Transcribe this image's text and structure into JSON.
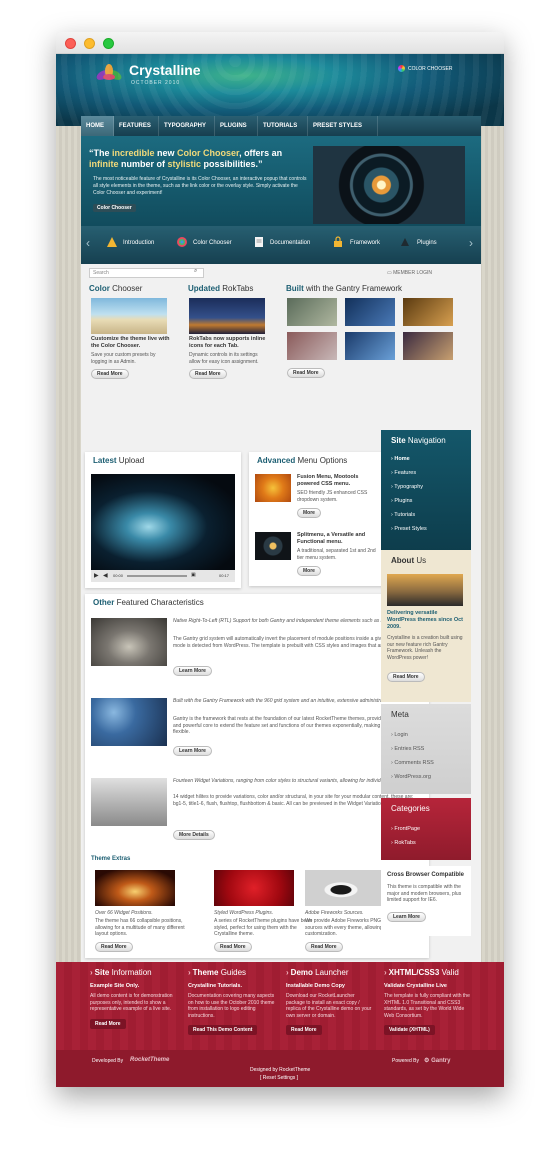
{
  "site": {
    "title": "Crystalline",
    "subtitle": "OCTOBER 2010",
    "color_chooser": "COLOR CHOOSER"
  },
  "nav": [
    "HOME",
    "FEATURES",
    "TYPOGRAPHY",
    "PLUGINS",
    "TUTORIALS",
    "PRESET STYLES"
  ],
  "showcase": {
    "quote_open": "“",
    "quote_1": "The ",
    "quote_hl1": "incredible",
    "quote_2": " new ",
    "quote_hl2": "Color Chooser",
    "quote_3": ", offers an ",
    "quote_hl3": "infinite",
    "quote_4": " number of ",
    "quote_hl4": "stylistic",
    "quote_5": " possibilities.",
    "quote_close": "”",
    "body": "The most noticeable feature of Crystalline is its Color Chooser, an interactive popup that controls all style elements in the theme, such as the link color or the overlay style. Simply activate the Color Chooser and experiment!",
    "button": "Color Chooser",
    "tabs": [
      "Introduction",
      "Color Chooser",
      "Documentation",
      "Framework",
      "Plugins"
    ]
  },
  "toolbar": {
    "search_placeholder": "Search",
    "member_login": "MEMBER LOGIN"
  },
  "features": [
    {
      "title_b": "Color",
      "title_r": " Chooser",
      "bold": "Customize the theme live with the Color Chooser.",
      "text": "Save your custom presets by logging in as Admin.",
      "btn": "Read More"
    },
    {
      "title_b": "Updated",
      "title_r": " RokTabs",
      "bold": "RokTabs now supports inline icons for each Tab.",
      "text": "Dynamic controls in its settings allow for easy icon assignment.",
      "btn": "Read More"
    },
    {
      "title_b": "Built",
      "title_r": " with the Gantry Framework",
      "btn": "Read More"
    }
  ],
  "latest_upload": {
    "title_b": "Latest",
    "title_r": " Upload",
    "time": "00:00",
    "duration": "00:17"
  },
  "advanced_menu": {
    "title_b": "Advanced",
    "title_r": " Menu Options",
    "items": [
      {
        "bold": "Fusion Menu, Mootools powered CSS menu.",
        "text": "SEO friendly JS enhanced CSS dropdown system.",
        "btn": "More"
      },
      {
        "bold": "Splitmenu, a Versatile and Functional menu.",
        "text": "A traditional, separated 1st and 2nd tier menu system.",
        "btn": "More"
      }
    ]
  },
  "other_features": {
    "title_b": "Other",
    "title_r": " Featured Characteristics",
    "items": [
      {
        "italic": "Native Right-To-Left (RTL) Support for both Gantry and independent theme elements such as module styling.",
        "text": "The Gantry grid system will automatically invert the placement of module positions inside a given row when RTL mode is detected from WordPress. The template is prebuilt with CSS styles and images that are peculiar to RTL.",
        "btn": "Learn More"
      },
      {
        "italic": "Built with the Gantry Framework with the 960 grid system and an intuitive, extensive administrative interface.",
        "text": "Gantry is the framework that rests at the foundation of our latest RocketTheme themes, providing an extensive and powerful core to extend the feature set and functions of our themes exponentially, making them even more flexible.",
        "btn": "Learn More"
      },
      {
        "italic": "Fourteen Widget Variations, ranging from color styles to structural variants, allowing for individual widget control.",
        "text": "14 widget hilites to provide variations, color and/or structural, in your site for your modular content, these are: bg1-5, title1-6, flush, flushtop, flushbottom & basic. All can be previewed in the Widget Variations page.",
        "btn": "More Details"
      }
    ]
  },
  "theme_extras": {
    "title": "Theme Extras",
    "items": [
      {
        "italic": "Over 66 Widget Positions.",
        "text": "The theme has 66 collapsible positions, allowing for a multitude of many different layout options.",
        "btn": "Read More"
      },
      {
        "italic": "Styled WordPress Plugins.",
        "text": "A series of RocketTheme plugins have been styled, perfect for using them with the Crystalline theme.",
        "btn": "Read More"
      },
      {
        "italic": "Adobe Fireworks Sources.",
        "text": "We provide Adobe Fireworks PNG image sources with every theme, allowing for quick customization.",
        "btn": "Read More"
      }
    ]
  },
  "sidebar": {
    "nav_title_b": "Site",
    "nav_title_r": " Navigation",
    "nav_items": [
      "Home",
      "Features",
      "Typography",
      "Plugins",
      "Tutorials",
      "Preset Styles"
    ],
    "about_title_b": "About",
    "about_title_r": " Us",
    "about_bold": "Delivering versatile WordPress themes since Oct 2009.",
    "about_text": "Crystalline is a creation built using our new feature rich Gantry Framework. Unleash the WordPress power!",
    "about_btn": "Read More",
    "meta_title": "Meta",
    "meta_items": [
      "Login",
      "Entries RSS",
      "Comments RSS",
      "WordPress.org"
    ],
    "cat_title": "Categories",
    "cat_items": [
      "FrontPage",
      "RokTabs"
    ],
    "compat_title": "Cross Browser Compatible",
    "compat_text": "This theme is compatible with the major and modern browsers, plus limited support for IE6.",
    "compat_btn": "Learn More"
  },
  "footer": {
    "boxes": [
      {
        "title_b": "Site",
        "title_r": " Information",
        "strong": "Example Site Only.",
        "text": "All demo content is for demonstration purposes only, intended to show a representative example of a live site.",
        "btn": "Read More"
      },
      {
        "title_b": "Theme",
        "title_r": " Guides",
        "strong": "Crystalline Tutorials.",
        "text": "Documentation covering many aspects on how to use the October 2010 theme from installation to logo editing instructions.",
        "btn": "Read This Demo Content"
      },
      {
        "title_b": "Demo",
        "title_r": " Launcher",
        "strong": "Installable Demo Copy",
        "text": "Download our RocketLauncher package to install an exact copy / replica of the Crystalline demo on your own server or domain.",
        "btn": "Read More"
      },
      {
        "title_b": "XHTML/CSS3",
        "title_r": " Valid",
        "strong": "Validate Crystalline Live",
        "text": "The template is fully compliant with the XHTML 1.0 Transitional and CSS3 standards, as set by the World Wide Web Consortium.",
        "btn": "Validate (XHTML)"
      }
    ],
    "developed_by": "Developed By",
    "rockettheme": "RocketTheme",
    "designed_by": "Designed by RocketTheme",
    "reset": "[ Reset Settings ]",
    "powered_by": "Powered By",
    "gantry": "Gantry"
  }
}
